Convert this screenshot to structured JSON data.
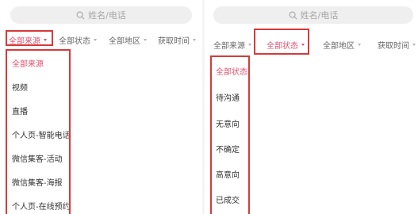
{
  "left": {
    "search": {
      "placeholder": "姓名/电话"
    },
    "filters": [
      {
        "label": "全部来源",
        "active": true
      },
      {
        "label": "全部状态",
        "active": false
      },
      {
        "label": "全部地区",
        "active": false
      },
      {
        "label": "获取时间",
        "active": false
      }
    ],
    "options": [
      "全部来源",
      "视频",
      "直播",
      "个人页-智能电话",
      "微信集客-活动",
      "微信集客-海报",
      "个人页-在线预约"
    ]
  },
  "right": {
    "search": {
      "placeholder": "姓名/电话"
    },
    "filters": [
      {
        "label": "全部来源",
        "active": false
      },
      {
        "label": "全部状态",
        "active": true
      },
      {
        "label": "全部地区",
        "active": false
      },
      {
        "label": "获取时间",
        "active": false
      }
    ],
    "options": [
      "全部状态",
      "待沟通",
      "无意向",
      "不确定",
      "高意向",
      "已成交"
    ]
  },
  "colors": {
    "accent": "#e0506e",
    "highlight_box": "#d63a3a",
    "search_bg": "#efefef"
  },
  "icons": {
    "search": "search-icon",
    "dropdown": "caret-down-icon"
  }
}
